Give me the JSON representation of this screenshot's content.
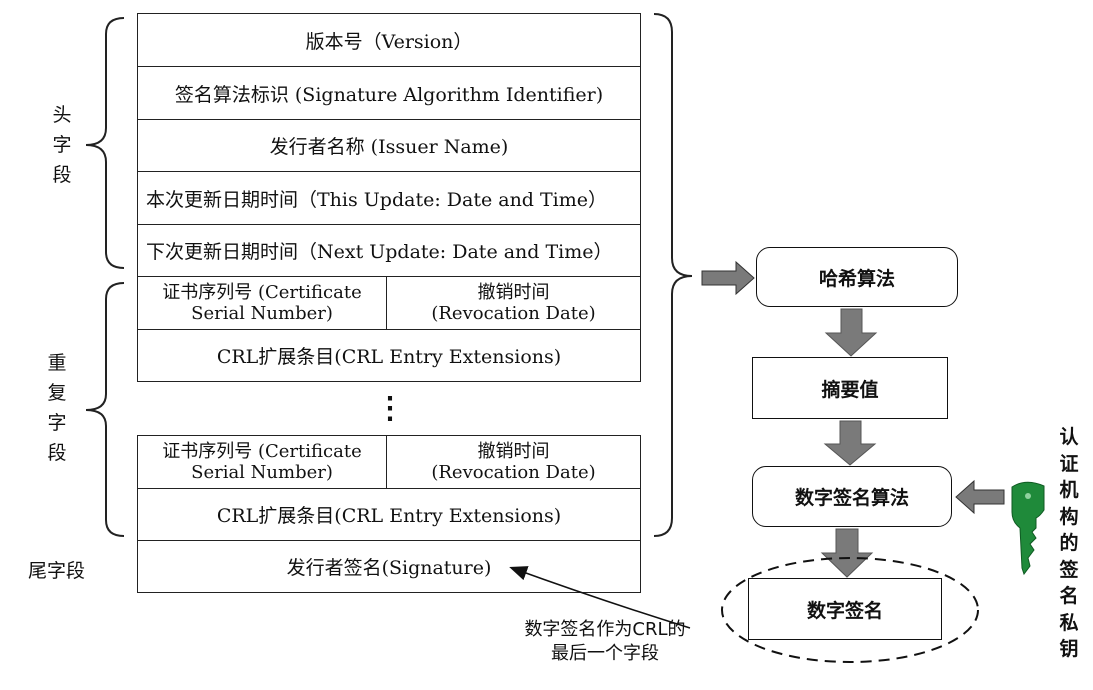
{
  "crl_fields": {
    "version": "版本号（Version）",
    "signature_algorithm": "签名算法标识 (Signature Algorithm Identifier)",
    "issuer_name": "发行者名称 (Issuer Name)",
    "this_update": "本次更新日期时间（This Update: Date and Time）",
    "next_update": "下次更新日期时间（Next Update: Date and Time）",
    "entries": [
      {
        "serial_line1": "证书序列号 (Certificate",
        "serial_line2": "Serial Number)",
        "revocation_line1": "撤销时间",
        "revocation_line2": "(Revocation Date)",
        "extensions": "CRL扩展条目(CRL Entry Extensions)"
      },
      {
        "serial_line1": "证书序列号 (Certificate",
        "serial_line2": "Serial Number)",
        "revocation_line1": "撤销时间",
        "revocation_line2": "(Revocation Date)",
        "extensions": "CRL扩展条目(CRL Entry Extensions)"
      }
    ],
    "ellipsis": "⋮",
    "signature": "发行者签名(Signature)"
  },
  "group_labels": {
    "header": [
      "头",
      "字",
      "段"
    ],
    "repeat": [
      "重",
      "复",
      "字",
      "段"
    ],
    "tail": "尾字段"
  },
  "flow": {
    "hash": "哈希算法",
    "digest": "摘要值",
    "sign_algorithm": "数字签名算法",
    "signature": "数字签名"
  },
  "caption": {
    "line1": "数字签名作为CRL的",
    "line2": "最后一个字段"
  },
  "key_label": [
    "认",
    "证",
    "机",
    "构",
    "的",
    "签",
    "名",
    "私",
    "钥"
  ],
  "colors": {
    "arrow_fill": "#7a7a7a",
    "key_green": "#1f8a3a",
    "line": "#222222"
  },
  "icons": {
    "key": "key-icon",
    "brace": "curly-brace-icon"
  }
}
